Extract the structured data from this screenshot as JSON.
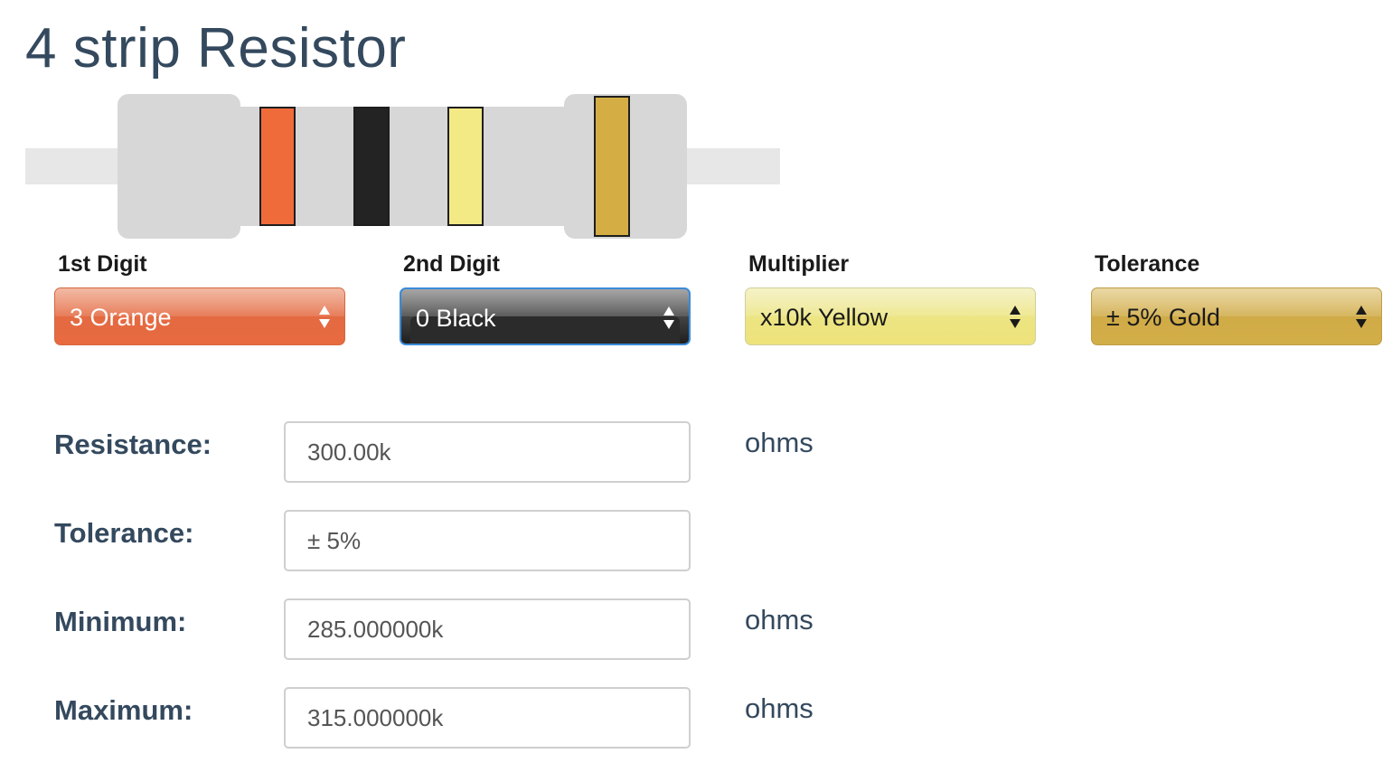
{
  "page": {
    "title": "4 strip Resistor"
  },
  "resistor": {
    "bands": [
      {
        "color_name": "orange",
        "color": "#f06b3a"
      },
      {
        "color_name": "black",
        "color": "#232323"
      },
      {
        "color_name": "yellow",
        "color": "#f3e985"
      },
      {
        "color_name": "gold",
        "color": "#d4ae45"
      }
    ]
  },
  "selectors": {
    "first_digit": {
      "label": "1st Digit",
      "value": "3 Orange"
    },
    "second_digit": {
      "label": "2nd Digit",
      "value": "0 Black"
    },
    "multiplier": {
      "label": "Multiplier",
      "value": "x10k Yellow"
    },
    "tolerance": {
      "label": "Tolerance",
      "value": "± 5% Gold"
    }
  },
  "results": {
    "resistance": {
      "label": "Resistance:",
      "value": "300.00k",
      "unit": "ohms"
    },
    "tolerance": {
      "label": "Tolerance:",
      "value": "± 5%",
      "unit": ""
    },
    "minimum": {
      "label": "Minimum:",
      "value": "285.000000k",
      "unit": "ohms"
    },
    "maximum": {
      "label": "Maximum:",
      "value": "315.000000k",
      "unit": "ohms"
    }
  }
}
